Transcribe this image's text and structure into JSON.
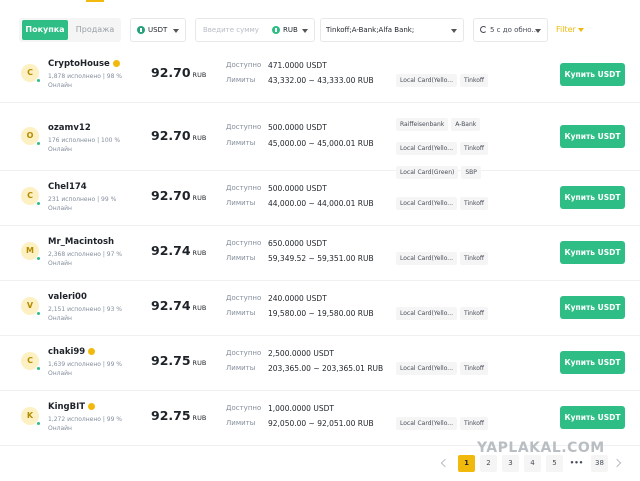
{
  "toolbar": {
    "buy_label": "Покупка",
    "sell_label": "Продажа",
    "asset": "USDT",
    "amount_placeholder": "Введите сумму",
    "fiat": "RUB",
    "banks": "Tinkoff;A-Bank;Alfa Bank;",
    "refresh": "5 с до обно...",
    "filter": "Filter"
  },
  "labels": {
    "available": "Доступно",
    "limits": "Лимиты",
    "buy_button": "Купить USDT",
    "currency": "RUB"
  },
  "ads": [
    {
      "initial": "C",
      "name": "CryptoHouse",
      "verified": true,
      "stats": "1,878 исполнено  |  98 %",
      "status": "Онлайн",
      "price": "92.70",
      "available": "471.0000 USDT",
      "limits": "43,332.00 ~ 43,333.00 RUB",
      "methods": [
        "Local Card(Yello...",
        "Tinkoff"
      ]
    },
    {
      "initial": "O",
      "name": "ozamv12",
      "verified": false,
      "stats": "176 исполнено  |  100 %",
      "status": "Онлайн",
      "price": "92.70",
      "available": "500.0000 USDT",
      "limits": "45,000.00 ~ 45,000.01 RUB",
      "methods": [
        "Raiffeisenbank",
        "A-Bank",
        "Local Card(Yello...",
        "Tinkoff",
        "Local Card(Green)",
        "SBP"
      ]
    },
    {
      "initial": "C",
      "name": "Chel174",
      "verified": false,
      "stats": "231 исполнено  |  99 %",
      "status": "Онлайн",
      "price": "92.70",
      "available": "500.0000 USDT",
      "limits": "44,000.00 ~ 44,000.01 RUB",
      "methods": [
        "Local Card(Yello...",
        "Tinkoff"
      ]
    },
    {
      "initial": "M",
      "name": "Mr_Macintosh",
      "verified": false,
      "stats": "2,368 исполнено  |  97 %",
      "status": "Онлайн",
      "price": "92.74",
      "available": "650.0000 USDT",
      "limits": "59,349.52 ~ 59,351.00 RUB",
      "methods": [
        "Local Card(Yello...",
        "Tinkoff"
      ]
    },
    {
      "initial": "V",
      "name": "valeri00",
      "verified": false,
      "stats": "2,151 исполнено  |  93 %",
      "status": "Онлайн",
      "price": "92.74",
      "available": "240.0000 USDT",
      "limits": "19,580.00 ~ 19,580.00 RUB",
      "methods": [
        "Local Card(Yello...",
        "Tinkoff"
      ]
    },
    {
      "initial": "C",
      "name": "chaki99",
      "verified": true,
      "stats": "1,639 исполнено  |  99 %",
      "status": "Онлайн",
      "price": "92.75",
      "available": "2,500.0000 USDT",
      "limits": "203,365.00 ~ 203,365.01 RUB",
      "methods": [
        "Local Card(Yello...",
        "Tinkoff"
      ]
    },
    {
      "initial": "K",
      "name": "KingBIT",
      "verified": true,
      "stats": "1,272 исполнено  |  99 %",
      "status": "Онлайн",
      "price": "92.75",
      "available": "1,000.0000 USDT",
      "limits": "92,050.00 ~ 92,051.00 RUB",
      "methods": [
        "Local Card(Yello...",
        "Tinkoff"
      ]
    }
  ],
  "pagination": {
    "pages": [
      "1",
      "2",
      "3",
      "4",
      "5",
      "•••",
      "38"
    ],
    "current": "1"
  },
  "watermark": "YAPLAKAL.COM"
}
